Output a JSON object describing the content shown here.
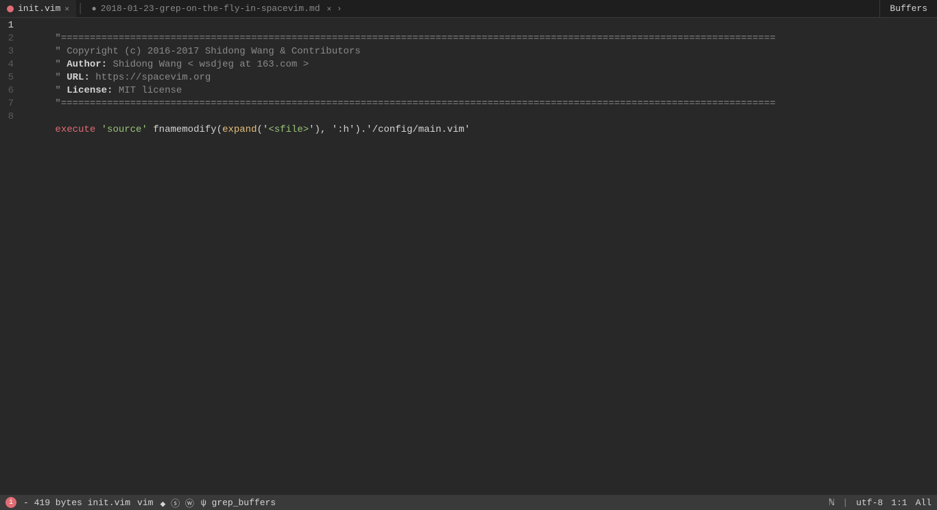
{
  "tabBar": {
    "tabs": [
      {
        "id": "init-vim",
        "label": "init.vim",
        "active": true,
        "iconType": "circle-red",
        "modified": false
      },
      {
        "id": "grep-md",
        "label": "2018-01-23-grep-on-the-fly-in-spacevim.md",
        "active": false,
        "iconType": "circle-modified",
        "modified": true
      }
    ],
    "buffersLabel": "Buffers"
  },
  "editor": {
    "lines": [
      {
        "number": 1,
        "active": true,
        "segments": [
          {
            "text": "\"",
            "class": "c-comment"
          },
          {
            "text": "============================================================================================================================",
            "class": "c-comment"
          }
        ]
      },
      {
        "number": 2,
        "active": false,
        "segments": [
          {
            "text": "\" ",
            "class": "c-comment"
          },
          {
            "text": "Copyright",
            "class": "c-comment"
          },
          {
            "text": " (c) 2016-2017 Shidong Wang & Contributors",
            "class": "c-comment"
          }
        ]
      },
      {
        "number": 3,
        "active": false,
        "segments": [
          {
            "text": "\" ",
            "class": "c-comment"
          },
          {
            "text": "Author:",
            "class": "c-bold"
          },
          {
            "text": " Shidong Wang < wsdjeg at 163.com >",
            "class": "c-comment"
          }
        ]
      },
      {
        "number": 4,
        "active": false,
        "segments": [
          {
            "text": "\" ",
            "class": "c-comment"
          },
          {
            "text": "URL:",
            "class": "c-bold"
          },
          {
            "text": " https://spacevim.org",
            "class": "c-comment"
          }
        ]
      },
      {
        "number": 5,
        "active": false,
        "segments": [
          {
            "text": "\" ",
            "class": "c-comment"
          },
          {
            "text": "License:",
            "class": "c-bold"
          },
          {
            "text": " MIT license",
            "class": "c-comment"
          }
        ]
      },
      {
        "number": 6,
        "active": false,
        "segments": [
          {
            "text": "\"",
            "class": "c-comment"
          },
          {
            "text": "============================================================================================================================",
            "class": "c-comment"
          }
        ]
      },
      {
        "number": 7,
        "active": false,
        "segments": []
      },
      {
        "number": 8,
        "active": false,
        "segments": [
          {
            "text": "execute",
            "class": "c-keyword-red"
          },
          {
            "text": " ",
            "class": "c-string"
          },
          {
            "text": "'source'",
            "class": "c-string-green"
          },
          {
            "text": " fnamemodify(",
            "class": "c-string"
          },
          {
            "text": "expand",
            "class": "c-keyword-yellow"
          },
          {
            "text": "('",
            "class": "c-string"
          },
          {
            "text": "<sfile>",
            "class": "c-string-green"
          },
          {
            "text": "'), '",
            "class": "c-string"
          },
          {
            "text": ":h",
            "class": "c-string"
          },
          {
            "text": "').'",
            "class": "c-string"
          },
          {
            "text": "/config/main.vim",
            "class": "c-string"
          },
          {
            "text": "'",
            "class": "c-string"
          }
        ]
      }
    ]
  },
  "statusBar": {
    "iconLabel": "i",
    "bytes": "419 bytes",
    "filename": "init.vim",
    "mode": "vim",
    "branch": "◆ ⓢ ⓦ",
    "plugin": "ψ grep_buffers",
    "encoding": "utf-8",
    "cursor": "1:1",
    "scrollPct": "All",
    "nerdFont": "ℕ"
  }
}
